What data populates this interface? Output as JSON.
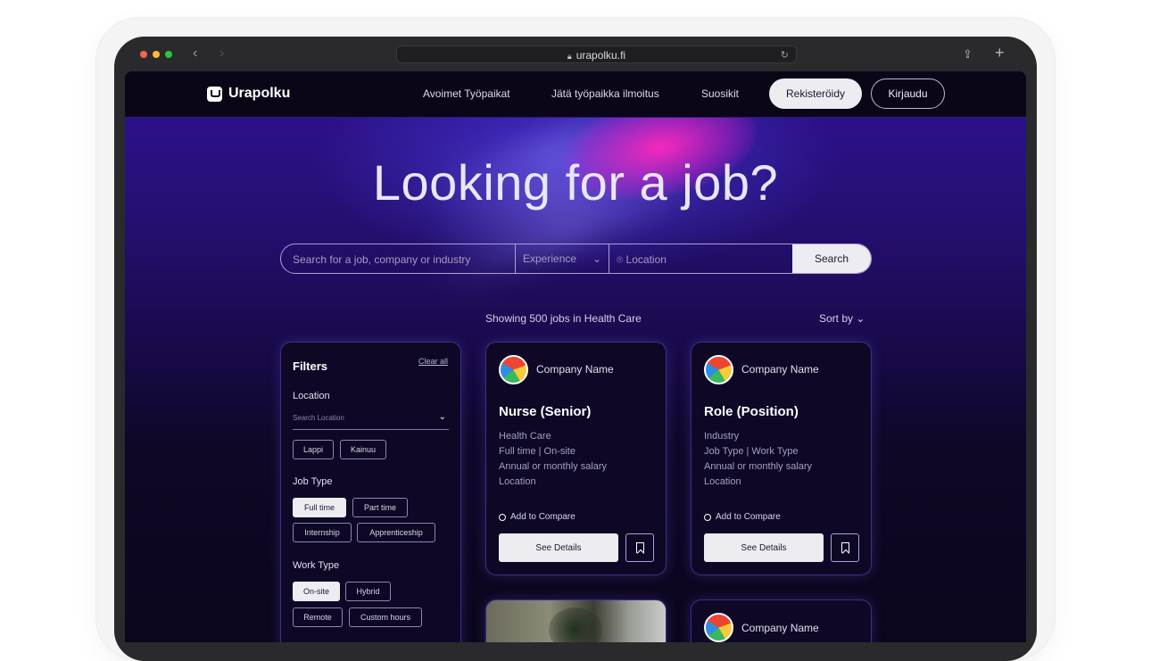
{
  "browser": {
    "url": "urapolku.fi"
  },
  "header": {
    "logo_text": "Urapolku",
    "nav": [
      "Avoimet Työpaikat",
      "Jätä työpaikka ilmoitus",
      "Suosikit"
    ],
    "register_label": "Rekisteröidy",
    "login_label": "Kirjaudu"
  },
  "hero": {
    "title": "Looking for a job?"
  },
  "search": {
    "keyword_placeholder": "Search for a job, company or industry",
    "experience_label": "Experience",
    "location_placeholder": "Location",
    "button_label": "Search"
  },
  "results": {
    "summary": "Showing 500 jobs in Health Care",
    "sort_label": "Sort by"
  },
  "filters": {
    "title": "Filters",
    "clear_label": "Clear all",
    "location_label": "Location",
    "location_placeholder": "Search Location",
    "location_chips": [
      {
        "label": "Lappi",
        "selected": false
      },
      {
        "label": "Kainuu",
        "selected": false
      }
    ],
    "job_type_label": "Job Type",
    "job_type_chips": [
      {
        "label": "Full time",
        "selected": true
      },
      {
        "label": "Part time",
        "selected": false
      },
      {
        "label": "Internship",
        "selected": false
      },
      {
        "label": "Apprenticeship",
        "selected": false
      }
    ],
    "work_type_label": "Work Type",
    "work_type_chips": [
      {
        "label": "On-site",
        "selected": true
      },
      {
        "label": "Hybrid",
        "selected": false
      },
      {
        "label": "Remote",
        "selected": false
      },
      {
        "label": "Custom hours",
        "selected": false
      }
    ]
  },
  "cards": [
    {
      "company": "Company Name",
      "title": "Nurse (Senior)",
      "industry": "Health Care",
      "type": "Full time | On-site",
      "salary": "Annual or monthly salary",
      "location": "Location",
      "compare_label": "Add to Compare",
      "details_label": "See Details"
    },
    {
      "company": "Company Name",
      "title": "Role (Position)",
      "industry": "Industry",
      "type": "Job Type | Work Type",
      "salary": "Annual or monthly salary",
      "location": "Location",
      "compare_label": "Add to Compare",
      "details_label": "See Details"
    },
    {
      "company": "Company Name"
    }
  ]
}
